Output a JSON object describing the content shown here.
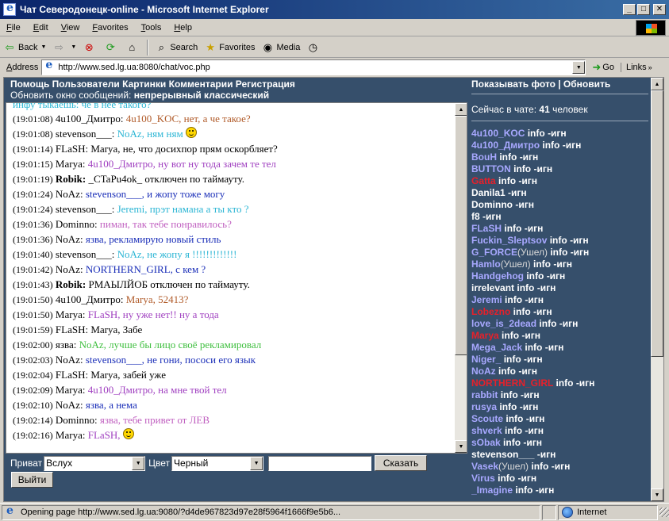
{
  "window": {
    "title": "Чат Северодонецк-online - Microsoft Internet Explorer",
    "minimize": "_",
    "maximize": "□",
    "close": "✕"
  },
  "menu": [
    "File",
    "Edit",
    "View",
    "Favorites",
    "Tools",
    "Help"
  ],
  "toolbar": {
    "back": "Back",
    "search": "Search",
    "favorites": "Favorites",
    "media": "Media"
  },
  "address": {
    "label": "Address",
    "url": "http://www.sed.lg.ua:8080/chat/voc.php",
    "go": "Go",
    "links": "Links"
  },
  "chat": {
    "header_row1": "Помощь Пользователи Картинки Комментарии Регистрация",
    "header_row2_prefix": "Обновить окно сообщений:",
    "header_row2_value": "непрерывный классический",
    "cut_line": "инфу тыкаешь: че в нее такого?",
    "messages": [
      {
        "time": "(19:01:08)",
        "who": "4u100_Дмитро:",
        "bold": false,
        "text": "4u100_KOC, нет, а че такое?",
        "color": "#b05a28",
        "smiley": false
      },
      {
        "time": "(19:01:08)",
        "who": "stevenson___:",
        "bold": false,
        "text": "NoAz, ням ням",
        "color": "#2bb5d4",
        "smiley": true
      },
      {
        "time": "(19:01:14)",
        "who": "FLaSH:",
        "bold": false,
        "text": "Marya, не, что досихпор прям оскорбляет?",
        "color": "#000000",
        "smiley": false
      },
      {
        "time": "(19:01:15)",
        "who": "Marya:",
        "bold": false,
        "text": "4u100_Дмитро, ну вот ну тода зачем те тел",
        "color": "#a040c0",
        "smiley": false
      },
      {
        "time": "(19:01:19)",
        "who": "Robik:",
        "bold": true,
        "text": "_CTaPu4ok_ отключен по таймауту.",
        "color": "#000000",
        "smiley": false
      },
      {
        "time": "(19:01:24)",
        "who": "NoAz:",
        "bold": false,
        "text": "stevenson___, и жопу тоже могу",
        "color": "#1a2eb8",
        "smiley": false
      },
      {
        "time": "(19:01:24)",
        "who": "stevenson___:",
        "bold": false,
        "text": "Jeremi, прэт намана а ты кто ?",
        "color": "#2bb5d4",
        "smiley": false
      },
      {
        "time": "(19:01:36)",
        "who": "Dominno:",
        "bold": false,
        "text": "пиман, так тебе понравилось?",
        "color": "#c060c0",
        "smiley": false
      },
      {
        "time": "(19:01:36)",
        "who": "NoAz:",
        "bold": false,
        "text": "язва, рекламирую новый стиль",
        "color": "#1a2eb8",
        "smiley": false
      },
      {
        "time": "(19:01:40)",
        "who": "stevenson___:",
        "bold": false,
        "text": "NoAz, не жопу я !!!!!!!!!!!!!",
        "color": "#2bb5d4",
        "smiley": false
      },
      {
        "time": "(19:01:42)",
        "who": "NoAz:",
        "bold": false,
        "text": "NORTHERN_GIRL, с кем ?",
        "color": "#1a2eb8",
        "smiley": false
      },
      {
        "time": "(19:01:43)",
        "who": "Robik:",
        "bold": true,
        "text": "РМАЫЛЙОБ отключен по таймауту.",
        "color": "#000000",
        "smiley": false
      },
      {
        "time": "(19:01:50)",
        "who": "4u100_Дмитро:",
        "bold": false,
        "text": "Marya, 52413?",
        "color": "#b05a28",
        "smiley": false
      },
      {
        "time": "(19:01:50)",
        "who": "Marya:",
        "bold": false,
        "text": "FLaSH, ну уже нет!! ну а тода",
        "color": "#a040c0",
        "smiley": false
      },
      {
        "time": "(19:01:59)",
        "who": "FLaSH:",
        "bold": false,
        "text": "Marya, Забе",
        "color": "#000000",
        "smiley": false
      },
      {
        "time": "(19:02:00)",
        "who": "язва:",
        "bold": false,
        "text": "NoAz, лучше бы лицо своё рекламировал",
        "color": "#3fbf3f",
        "smiley": false
      },
      {
        "time": "(19:02:03)",
        "who": "NoAz:",
        "bold": false,
        "text": "stevenson___, не гони, пососи его язык",
        "color": "#1a2eb8",
        "smiley": false
      },
      {
        "time": "(19:02:04)",
        "who": "FLaSH:",
        "bold": false,
        "text": "Marya, забей уже",
        "color": "#000000",
        "smiley": false
      },
      {
        "time": "(19:02:09)",
        "who": "Marya:",
        "bold": false,
        "text": "4u100_Дмитро, на мне твой тел",
        "color": "#a040c0",
        "smiley": false
      },
      {
        "time": "(19:02:10)",
        "who": "NoAz:",
        "bold": false,
        "text": "язва, а нема",
        "color": "#1a2eb8",
        "smiley": false
      },
      {
        "time": "(19:02:14)",
        "who": "Dominno:",
        "bold": false,
        "text": "язва, тебе привет от ЛЕВ",
        "color": "#c060c0",
        "smiley": false
      },
      {
        "time": "(19:02:16)",
        "who": "Marya:",
        "bold": false,
        "text": "FLaSH,",
        "color": "#a040c0",
        "smiley": true
      }
    ],
    "private_label": "Приват",
    "private_value": "Вслух",
    "color_label": "Цвет",
    "color_value": "Черный",
    "message_input": "",
    "send_button": "Сказать",
    "exit_button": "Выйти"
  },
  "users_panel": {
    "header": "Показывать фото | Обновить",
    "count_prefix": "Сейчас в чате:",
    "count": "41",
    "count_suffix": "человек",
    "info_label": "info",
    "ignore_label": "-игн",
    "away_label": "(Ушел)",
    "users": [
      {
        "name": "4u100_KOC",
        "color": "#a8a8ff",
        "info": true,
        "away": false
      },
      {
        "name": "4u100_Дмитро",
        "color": "#a8a8ff",
        "info": true,
        "away": false
      },
      {
        "name": "BouH",
        "color": "#a8a8ff",
        "info": true,
        "away": false
      },
      {
        "name": "BUTTON",
        "color": "#a8a8ff",
        "info": true,
        "away": false
      },
      {
        "name": "Gatta",
        "color": "#e8202a",
        "info": true,
        "away": false
      },
      {
        "name": "Danila1",
        "color": "#ffffff",
        "info": false,
        "away": false
      },
      {
        "name": "Dominno",
        "color": "#ffffff",
        "info": false,
        "away": false
      },
      {
        "name": "f8",
        "color": "#ffffff",
        "info": false,
        "away": false
      },
      {
        "name": "FLaSH",
        "color": "#a8a8ff",
        "info": true,
        "away": false
      },
      {
        "name": "Fuckin_Sleptsov",
        "color": "#a8a8ff",
        "info": true,
        "away": false
      },
      {
        "name": "G_FORCE",
        "color": "#a8a8ff",
        "info": true,
        "away": true
      },
      {
        "name": "Hamlo",
        "color": "#a8a8ff",
        "info": true,
        "away": true
      },
      {
        "name": "Handgehog",
        "color": "#a8a8ff",
        "info": true,
        "away": false
      },
      {
        "name": "irrelevant",
        "color": "#ffffff",
        "info": true,
        "away": false
      },
      {
        "name": "Jeremi",
        "color": "#a8a8ff",
        "info": true,
        "away": false
      },
      {
        "name": "Lobezno",
        "color": "#e8202a",
        "info": true,
        "away": false
      },
      {
        "name": "love_is_2dead",
        "color": "#a8a8ff",
        "info": true,
        "away": false
      },
      {
        "name": "Marya",
        "color": "#e8202a",
        "info": true,
        "away": false
      },
      {
        "name": "Mega_Jack",
        "color": "#a8a8ff",
        "info": true,
        "away": false
      },
      {
        "name": "Niger_",
        "color": "#a8a8ff",
        "info": true,
        "away": false
      },
      {
        "name": "NoAz",
        "color": "#a8a8ff",
        "info": true,
        "away": false
      },
      {
        "name": "NORTHERN_GIRL",
        "color": "#e8202a",
        "info": true,
        "away": false
      },
      {
        "name": "rabbit",
        "color": "#a8a8ff",
        "info": true,
        "away": false
      },
      {
        "name": "rusya",
        "color": "#a8a8ff",
        "info": true,
        "away": false
      },
      {
        "name": "Scoute",
        "color": "#a8a8ff",
        "info": true,
        "away": false
      },
      {
        "name": "shverk",
        "color": "#a8a8ff",
        "info": true,
        "away": false
      },
      {
        "name": "sObak",
        "color": "#a8a8ff",
        "info": true,
        "away": false
      },
      {
        "name": "stevenson___",
        "color": "#ffffff",
        "info": false,
        "away": false
      },
      {
        "name": "Vasek",
        "color": "#a8a8ff",
        "info": true,
        "away": true
      },
      {
        "name": "Virus",
        "color": "#a8a8ff",
        "info": true,
        "away": false
      },
      {
        "name": "_Imagine",
        "color": "#a8a8ff",
        "info": true,
        "away": false
      }
    ]
  },
  "status": {
    "text": "Opening page http://www.sed.lg.ua:9080/?d4de967823d97e28f5964f1666f9e5b6...",
    "zone": "Internet"
  }
}
